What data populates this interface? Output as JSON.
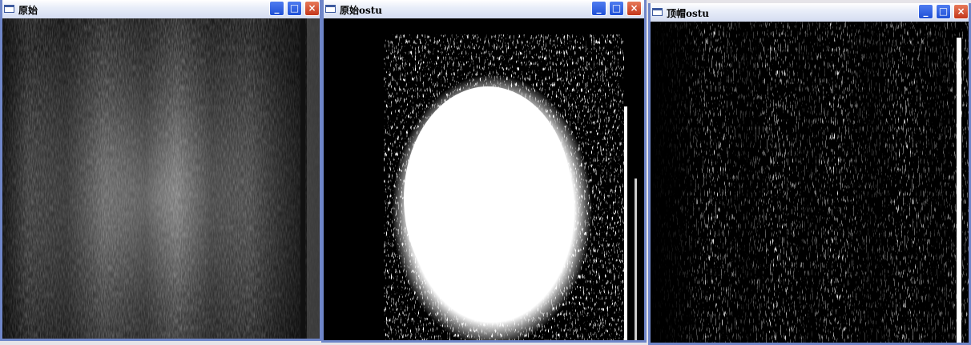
{
  "windows": [
    {
      "id": "original",
      "title": "原始",
      "buttons": {
        "minimize": "_",
        "maximize": "□",
        "close": "×"
      }
    },
    {
      "id": "original-otsu",
      "title": "原始ostu",
      "buttons": {
        "minimize": "_",
        "maximize": "□",
        "close": "×"
      }
    },
    {
      "id": "tophat-otsu",
      "title": "顶帽ostu",
      "buttons": {
        "minimize": "_",
        "maximize": "□",
        "close": "×"
      }
    }
  ],
  "colors": {
    "title_bar": "#e9eef9",
    "window_border": "#6f86c9",
    "button_blue": "#2d5ee0",
    "button_close": "#d0482a",
    "image_background": "#000000"
  },
  "icons": [
    "window-icon",
    "minimize-icon",
    "maximize-icon",
    "close-icon"
  ]
}
